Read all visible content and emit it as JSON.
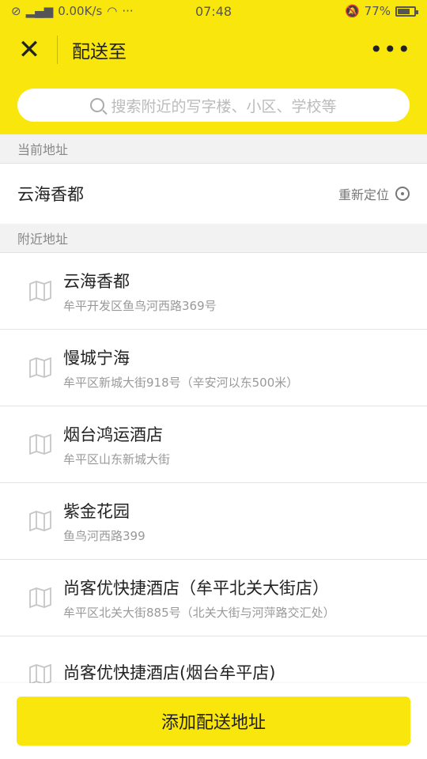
{
  "status_bar": {
    "network_speed": "0.00K/s",
    "time": "07:48",
    "battery": "77%",
    "battery_level": 0.77
  },
  "header": {
    "close_label": "✕",
    "title": "配送至",
    "more_label": "•••"
  },
  "search": {
    "placeholder": "搜索附近的写字楼、小区、学校等"
  },
  "current_section": {
    "title": "当前地址",
    "name": "云海香都",
    "relocate_label": "重新定位"
  },
  "nearby_section": {
    "title": "附近地址",
    "items": [
      {
        "name": "云海香都",
        "address": "牟平开发区鱼鸟河西路369号"
      },
      {
        "name": "慢城宁海",
        "address": "牟平区新城大街918号（辛安河以东500米）"
      },
      {
        "name": "烟台鸿运酒店",
        "address": "牟平区山东新城大街"
      },
      {
        "name": "紫金花园",
        "address": "鱼鸟河西路399"
      },
      {
        "name": "尚客优快捷酒店（牟平北关大街店）",
        "address": "牟平区北关大街885号（北关大街与河萍路交汇处）"
      },
      {
        "name": "尚客优快捷酒店(烟台牟平店)",
        "address": ""
      }
    ]
  },
  "bottom": {
    "add_label": "添加配送地址"
  },
  "colors": {
    "brand_yellow": "#f9e60c"
  }
}
